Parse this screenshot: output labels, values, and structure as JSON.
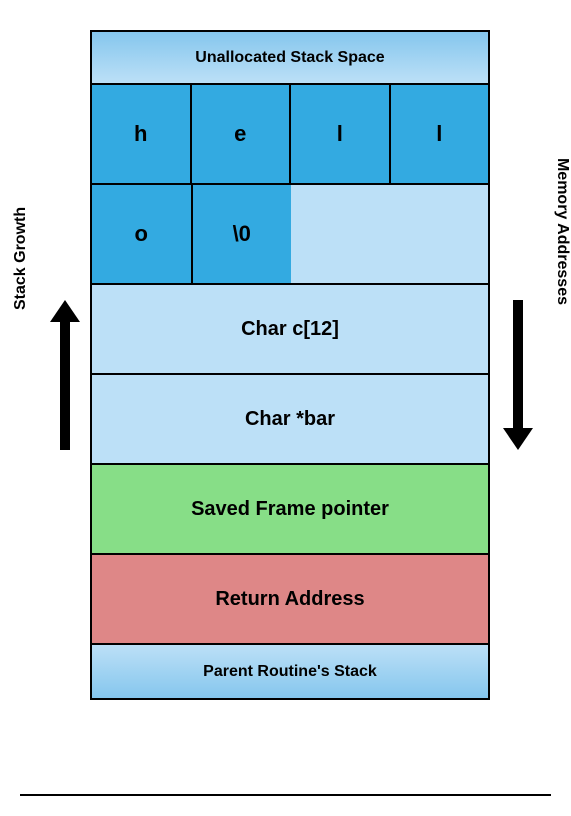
{
  "sections": {
    "unallocated": "Unallocated Stack Space",
    "char_c": "Char c[12]",
    "char_bar": "Char *bar",
    "saved_frame": "Saved Frame pointer",
    "return_address": "Return Address",
    "parent": "Parent Routine's Stack"
  },
  "bytes_row1": {
    "b0": "h",
    "b1": "e",
    "b2": "l",
    "b3": "l"
  },
  "bytes_row2": {
    "b0": "o",
    "b1": "\\0"
  },
  "labels": {
    "stack_growth": "Stack Growth",
    "memory_addresses": "Memory Addresses"
  }
}
